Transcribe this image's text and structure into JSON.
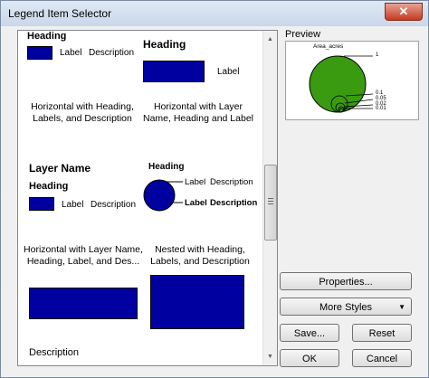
{
  "window": {
    "title": "Legend Item Selector",
    "close_glyph": "✕"
  },
  "gallery": {
    "item1": {
      "heading": "Heading",
      "label": "Label",
      "description": "Description",
      "caption": "Horizontal with Heading, Labels, and Description"
    },
    "item2": {
      "heading": "Heading",
      "label": "Label",
      "caption": "Horizontal with Layer Name, Heading and Label"
    },
    "item3": {
      "layer_name": "Layer Name",
      "heading": "Heading",
      "label": "Label",
      "description": "Description",
      "caption": "Horizontal with Layer Name, Heading, Label, and Des..."
    },
    "item4": {
      "heading": "Heading",
      "label1": "Label",
      "description1": "Description",
      "label2": "Label",
      "description2": "Description",
      "caption": "Nested with Heading, Labels, and Description"
    },
    "item7": {
      "caption": "Description"
    }
  },
  "preview": {
    "label": "Preview",
    "title": "Area_acres",
    "labels": [
      "1",
      "0.1",
      "0.05",
      "0.02",
      "0.01"
    ],
    "fill_color": "#3a9a10"
  },
  "buttons": {
    "properties": "Properties...",
    "more_styles": "More Styles",
    "save": "Save...",
    "reset": "Reset",
    "ok": "OK",
    "cancel": "Cancel"
  },
  "colors": {
    "patch": "#0000a0",
    "accent": "#3a9a10"
  },
  "icons": {
    "close": "close-icon",
    "scroll_up": "scroll-up-arrow-icon",
    "scroll_down": "scroll-down-arrow-icon",
    "dropdown": "dropdown-arrow-icon"
  }
}
